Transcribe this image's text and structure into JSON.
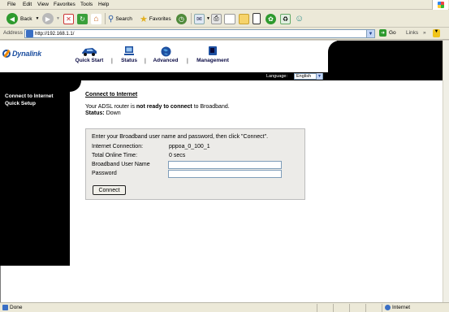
{
  "browser": {
    "menu": [
      "File",
      "Edit",
      "View",
      "Favorites",
      "Tools",
      "Help"
    ],
    "toolbar": {
      "back_label": "Back",
      "search_label": "Search",
      "favorites_label": "Favorites"
    },
    "address": {
      "label": "Address",
      "url": "http://192.168.1.1/",
      "go_label": "Go",
      "links_label": "Links"
    },
    "status": {
      "text": "Done",
      "zone": "Internet"
    }
  },
  "router": {
    "logo": "Dynalink",
    "nav": [
      {
        "label": "Quick Start",
        "icon": "car-icon"
      },
      {
        "label": "Status",
        "icon": "monitor-icon"
      },
      {
        "label": "Advanced",
        "icon": "globe-icon"
      },
      {
        "label": "Management",
        "icon": "book-icon"
      }
    ],
    "language": {
      "label": "Language:",
      "selected": "English"
    },
    "sidebar": [
      "Connect to Internet",
      "Quick Setup"
    ],
    "page_title": "Connect to Internet",
    "message": {
      "prefix": "Your ADSL router is ",
      "emphasis": "not ready to connect",
      "suffix": " to Broadband."
    },
    "status_label": "Status:",
    "status_value": "Down",
    "form": {
      "instruction": "Enter your Broadband user name and password, then click \"Connect\".",
      "connection_label": "Internet Connection:",
      "connection_value": "pppoa_0_100_1",
      "online_label": "Total Online Time:",
      "online_value": "0 secs",
      "username_label": "Broadband User Name",
      "username_value": "",
      "password_label": "Password",
      "password_value": "",
      "button": "Connect"
    }
  }
}
